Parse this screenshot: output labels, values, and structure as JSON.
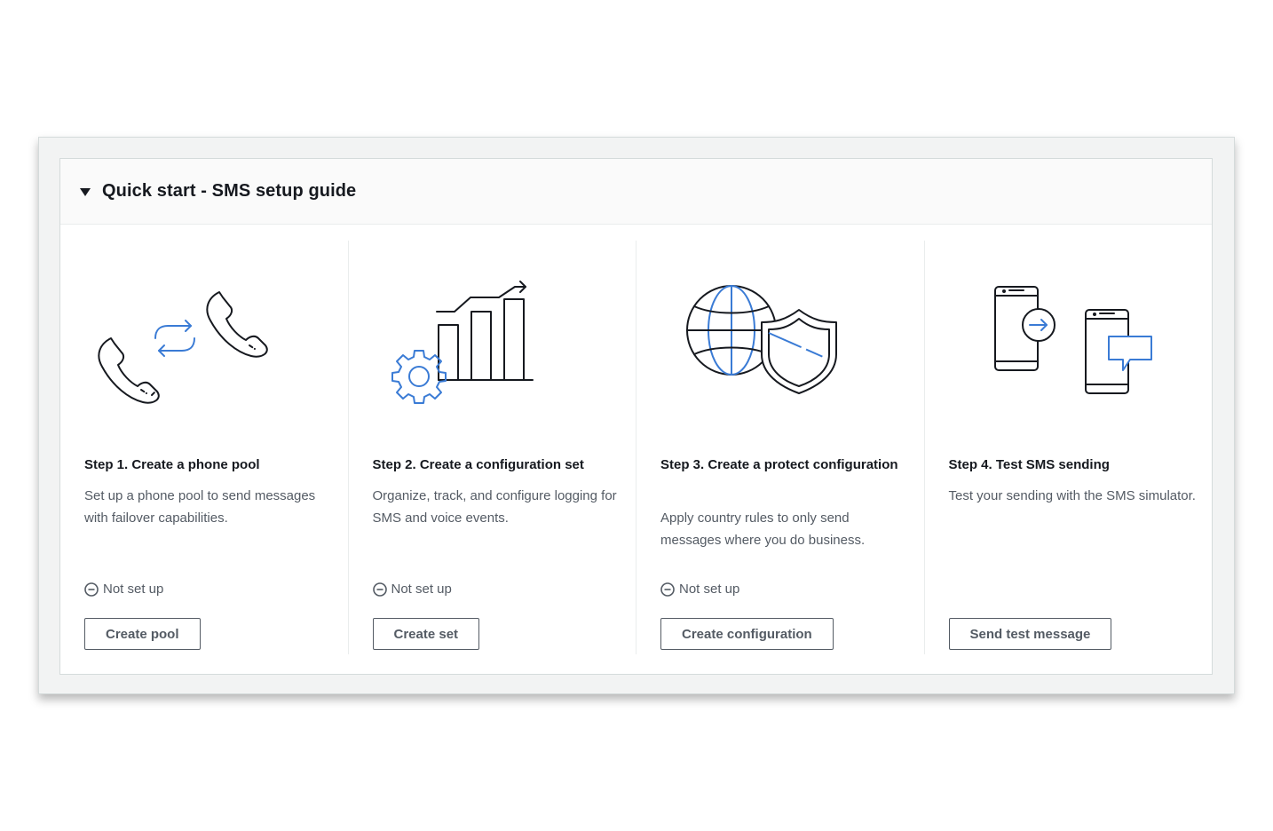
{
  "panel": {
    "title": "Quick start - SMS setup guide"
  },
  "steps": [
    {
      "title": "Step 1. Create a phone pool",
      "description": "Set up a phone pool to send messages with failover capabilities.",
      "status": "Not set up",
      "button": "Create pool",
      "icon": "phone-pool-icon"
    },
    {
      "title": "Step 2. Create a configuration set",
      "description": "Organize, track, and configure logging for SMS and voice events.",
      "status": "Not set up",
      "button": "Create set",
      "icon": "configuration-set-icon"
    },
    {
      "title": "Step 3. Create a protect configuration",
      "description": "Apply country rules to only send messages where you do business.",
      "status": "Not set up",
      "button": "Create configuration",
      "icon": "globe-shield-icon"
    },
    {
      "title": "Step 4. Test SMS sending",
      "description": "Test your sending with the SMS simulator.",
      "status": "",
      "button": "Send test message",
      "icon": "test-sms-icon"
    }
  ],
  "colors": {
    "icon_dark": "#16191f",
    "icon_accent": "#3a7bd5",
    "text_secondary": "#545b64",
    "panel_header_bg": "#fafafa",
    "frame_bg": "#f2f3f3"
  }
}
